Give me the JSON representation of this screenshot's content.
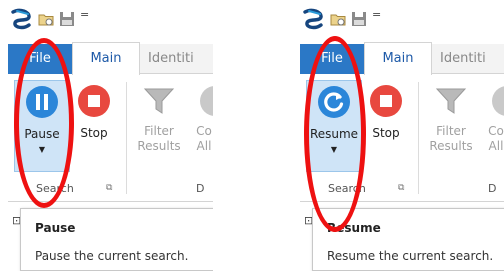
{
  "panels": [
    {
      "tabs": {
        "file": "File",
        "main": "Main",
        "identities": "Identiti"
      },
      "ribbon": {
        "main_button": {
          "label": "Pause",
          "icon": "pause-icon",
          "color": "#2b86d9"
        },
        "stop_button": {
          "label": "Stop",
          "icon": "stop-icon"
        },
        "filter_button": {
          "line1": "Filter",
          "line2": "Results"
        },
        "columns_button": {
          "line1": "Co",
          "line2": "All"
        },
        "group_label": "Search",
        "next_group_label": "D"
      },
      "tooltip": {
        "title": "Pause",
        "description": "Pause the current search."
      }
    },
    {
      "tabs": {
        "file": "File",
        "main": "Main",
        "identities": "Identiti"
      },
      "ribbon": {
        "main_button": {
          "label": "Resume",
          "icon": "resume-icon",
          "color": "#2b86d9"
        },
        "stop_button": {
          "label": "Stop",
          "icon": "stop-icon"
        },
        "filter_button": {
          "line1": "Filter",
          "line2": "Results"
        },
        "columns_button": {
          "line1": "Co",
          "line2": "All"
        },
        "group_label": "Search",
        "next_group_label": "D"
      },
      "tooltip": {
        "title": "Resume",
        "description": "Resume the current search."
      }
    }
  ],
  "colors": {
    "file_tab": "#2b78c6",
    "accent": "#2b86d9",
    "stop_red": "#e8483f",
    "highlight": "#cfe4f7",
    "annotation": "#ee1111"
  }
}
